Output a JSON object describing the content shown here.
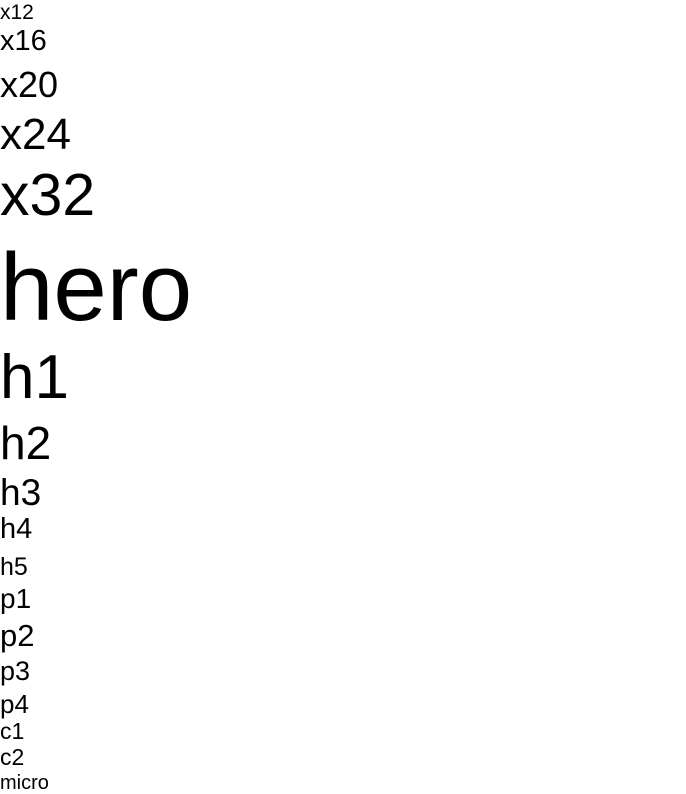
{
  "samples": {
    "x12": "x12",
    "x16": "x16",
    "x20": "x20",
    "x24": "x24",
    "x32": "x32",
    "hero": "hero",
    "h1": "h1",
    "h2": "h2",
    "h3": "h3",
    "h4": "h4",
    "h5": "h5",
    "p1": "p1",
    "p2": "p2",
    "p3": "p3",
    "p4": "p4",
    "c1": "c1",
    "c2": "c2",
    "micro": "micro"
  },
  "colors": {
    "text": "#000000",
    "background": "#ffffff"
  }
}
